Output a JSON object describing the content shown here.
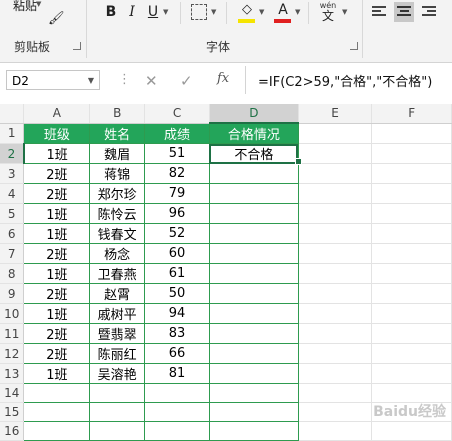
{
  "ribbon": {
    "paste_label": "粘贴",
    "clipboard_group": "剪贴板",
    "font_group": "字体",
    "bold": "B",
    "italic": "I",
    "underline": "U",
    "wen_label": "wén",
    "wen_char": "文",
    "font_color_letter": "A"
  },
  "formula_bar": {
    "name_box": "D2",
    "cancel": "✕",
    "enter": "✓",
    "fx": "fx",
    "formula": "=IF(C2>59,\"合格\",\"不合格\")"
  },
  "columns": [
    "A",
    "B",
    "C",
    "D",
    "E",
    "F"
  ],
  "rows": [
    {
      "n": "1",
      "a": "班级",
      "b": "姓名",
      "c": "成绩",
      "d": "合格情况"
    },
    {
      "n": "2",
      "a": "1班",
      "b": "魏眉",
      "c": "51",
      "d": "不合格"
    },
    {
      "n": "3",
      "a": "2班",
      "b": "蒋锦",
      "c": "82",
      "d": ""
    },
    {
      "n": "4",
      "a": "2班",
      "b": "郑尔珍",
      "c": "79",
      "d": ""
    },
    {
      "n": "5",
      "a": "1班",
      "b": "陈怜云",
      "c": "96",
      "d": ""
    },
    {
      "n": "6",
      "a": "1班",
      "b": "钱春文",
      "c": "52",
      "d": ""
    },
    {
      "n": "7",
      "a": "2班",
      "b": "杨念",
      "c": "60",
      "d": ""
    },
    {
      "n": "8",
      "a": "1班",
      "b": "卫春燕",
      "c": "61",
      "d": ""
    },
    {
      "n": "9",
      "a": "2班",
      "b": "赵霄",
      "c": "50",
      "d": ""
    },
    {
      "n": "10",
      "a": "1班",
      "b": "戚树平",
      "c": "94",
      "d": ""
    },
    {
      "n": "11",
      "a": "2班",
      "b": "暨翡翠",
      "c": "83",
      "d": ""
    },
    {
      "n": "12",
      "a": "2班",
      "b": "陈丽红",
      "c": "66",
      "d": ""
    },
    {
      "n": "13",
      "a": "1班",
      "b": "吴溶艳",
      "c": "81",
      "d": ""
    },
    {
      "n": "14",
      "a": "",
      "b": "",
      "c": "",
      "d": ""
    },
    {
      "n": "15",
      "a": "",
      "b": "",
      "c": "",
      "d": ""
    },
    {
      "n": "16",
      "a": "",
      "b": "",
      "c": "",
      "d": ""
    }
  ],
  "watermark": "Baidu经验",
  "colors": {
    "header_fill": "#23a55a",
    "selection": "#1e7145",
    "font_color": "#e02020",
    "highlight": "#f5e400"
  }
}
